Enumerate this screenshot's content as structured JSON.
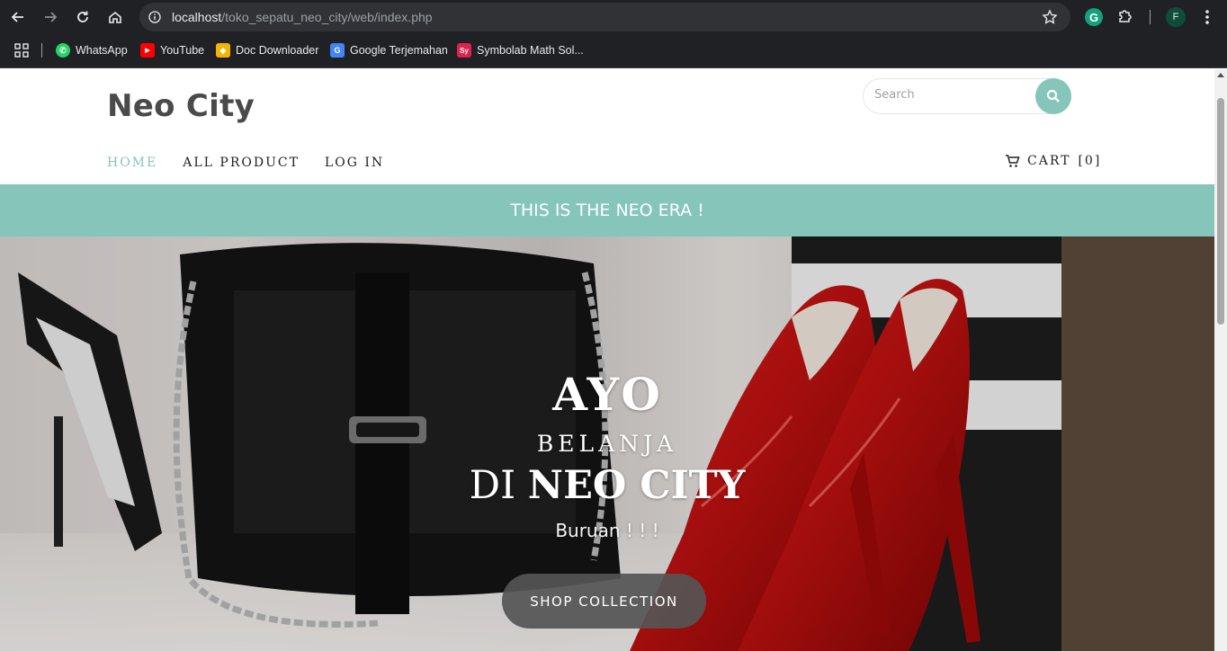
{
  "browser": {
    "url_host": "localhost",
    "url_path": "/toko_sepatu_neo_city/web/index.php",
    "profile_initial": "F",
    "extension_initial": "G"
  },
  "bookmarks": [
    {
      "label": "WhatsApp",
      "color": "#25d366",
      "glyph": "✆"
    },
    {
      "label": "YouTube",
      "color": "#ff0000",
      "glyph": "▶"
    },
    {
      "label": "Doc Downloader",
      "color": "#f4b400",
      "glyph": "◆"
    },
    {
      "label": "Google Terjemahan",
      "color": "#4285f4",
      "glyph": "G"
    },
    {
      "label": "Symbolab Math Sol...",
      "color": "#e0224f",
      "glyph": "Sy"
    }
  ],
  "site": {
    "brand": "Neo City",
    "search_placeholder": "Search",
    "menu": [
      {
        "label": "HOME",
        "active": true
      },
      {
        "label": "ALL PRODUCT",
        "active": false
      },
      {
        "label": "LOG IN",
        "active": false
      }
    ],
    "cart_label": "CART",
    "cart_count": "[0]",
    "banner": "THIS IS THE NEO ERA !",
    "accent_color": "#86c5ba"
  },
  "hero": {
    "line1": "AYO",
    "line2": "BELANJA",
    "line3_light": "DI",
    "line3_bold": "NEO CITY",
    "line4": "Buruan ! ! !",
    "button": "SHOP COLLECTION"
  }
}
